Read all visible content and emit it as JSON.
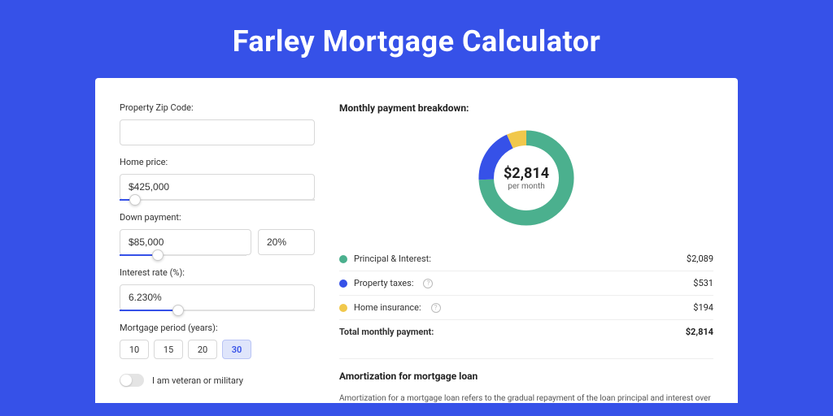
{
  "title": "Farley Mortgage Calculator",
  "form": {
    "zip_label": "Property Zip Code:",
    "zip_value": "",
    "home_price_label": "Home price:",
    "home_price_value": "$425,000",
    "home_price_slider_pct": 8,
    "down_payment_label": "Down payment:",
    "down_payment_value": "$85,000",
    "down_payment_pct": "20%",
    "down_payment_slider_pct": 20,
    "interest_label": "Interest rate (%):",
    "interest_value": "6.230%",
    "interest_slider_pct": 30,
    "period_label": "Mortgage period (years):",
    "period_options": [
      "10",
      "15",
      "20",
      "30"
    ],
    "period_selected": "30",
    "veteran_label": "I am veteran or military"
  },
  "breakdown": {
    "title": "Monthly payment breakdown:",
    "center_amount": "$2,814",
    "center_sub": "per month",
    "items": [
      {
        "label": "Principal & Interest:",
        "value": "$2,089",
        "color": "#4bb08e",
        "info": false
      },
      {
        "label": "Property taxes:",
        "value": "$531",
        "color": "#3651e8",
        "info": true
      },
      {
        "label": "Home insurance:",
        "value": "$194",
        "color": "#f1c84c",
        "info": true
      }
    ],
    "total_label": "Total monthly payment:",
    "total_value": "$2,814"
  },
  "chart_data": {
    "type": "pie",
    "title": "Monthly payment breakdown",
    "series": [
      {
        "name": "Principal & Interest",
        "value": 2089,
        "color": "#4bb08e"
      },
      {
        "name": "Property taxes",
        "value": 531,
        "color": "#3651e8"
      },
      {
        "name": "Home insurance",
        "value": 194,
        "color": "#f1c84c"
      }
    ],
    "total": 2814,
    "center_label": "$2,814 per month"
  },
  "amortization": {
    "title": "Amortization for mortgage loan",
    "text": "Amortization for a mortgage loan refers to the gradual repayment of the loan principal and interest over a specified"
  }
}
